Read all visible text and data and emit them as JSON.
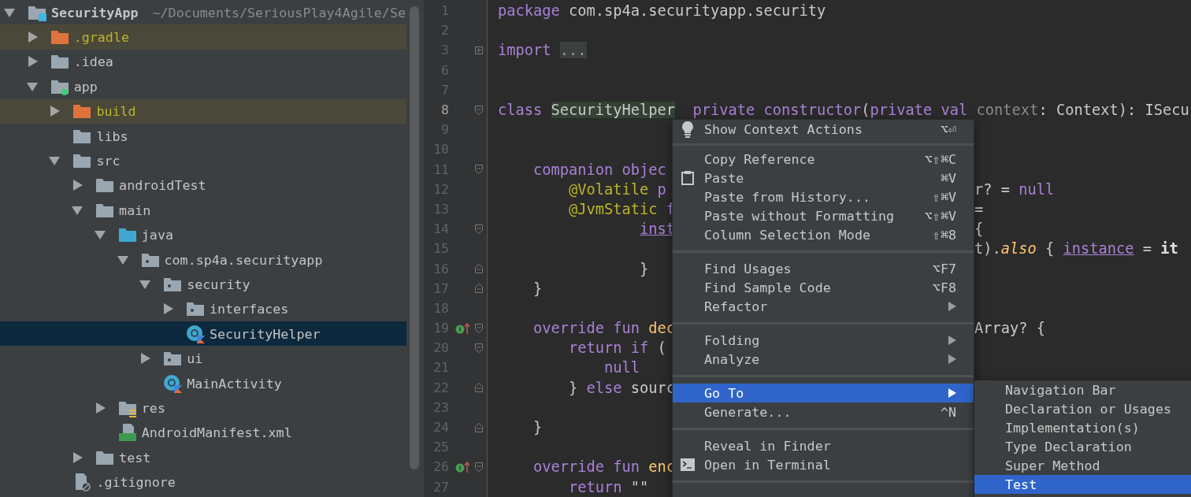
{
  "project_tree": {
    "root": {
      "label": "SecurityApp",
      "path": "~/Documents/SeriousPlay4Agile/Se",
      "kind": "module",
      "expanded": true,
      "selected": false,
      "children": [
        {
          "label": ".gradle",
          "kind": "excluded",
          "expanded": false,
          "selected": false
        },
        {
          "label": ".idea",
          "kind": "folder",
          "expanded": false,
          "selected": false
        },
        {
          "label": "app",
          "kind": "app",
          "expanded": true,
          "selected": false,
          "children": [
            {
              "label": "build",
              "kind": "excluded",
              "expanded": false,
              "selected": false
            },
            {
              "label": "libs",
              "kind": "folder",
              "selected": false
            },
            {
              "label": "src",
              "kind": "folder",
              "expanded": true,
              "selected": false,
              "children": [
                {
                  "label": "androidTest",
                  "kind": "folder",
                  "expanded": false,
                  "selected": false
                },
                {
                  "label": "main",
                  "kind": "folder",
                  "expanded": true,
                  "selected": false,
                  "children": [
                    {
                      "label": "java",
                      "kind": "source",
                      "expanded": true,
                      "selected": false,
                      "children": [
                        {
                          "label": "com.sp4a.securityapp",
                          "kind": "package",
                          "expanded": true,
                          "selected": false,
                          "children": [
                            {
                              "label": "security",
                              "kind": "package",
                              "expanded": true,
                              "selected": false,
                              "children": [
                                {
                                  "label": "interfaces",
                                  "kind": "package",
                                  "expanded": false,
                                  "selected": false
                                },
                                {
                                  "label": "SecurityHelper",
                                  "kind": "kotlin",
                                  "selected": true
                                }
                              ]
                            },
                            {
                              "label": "ui",
                              "kind": "package",
                              "expanded": false,
                              "selected": false
                            },
                            {
                              "label": "MainActivity",
                              "kind": "kotlin",
                              "selected": false
                            }
                          ]
                        }
                      ]
                    },
                    {
                      "label": "res",
                      "kind": "res",
                      "expanded": false,
                      "selected": false
                    },
                    {
                      "label": "AndroidManifest.xml",
                      "kind": "manifest",
                      "selected": false
                    }
                  ]
                },
                {
                  "label": "test",
                  "kind": "folder",
                  "expanded": false,
                  "selected": false
                }
              ]
            },
            {
              "label": ".gitignore",
              "kind": "ignored",
              "selected": false
            }
          ]
        }
      ]
    }
  },
  "editor": {
    "lines": [
      {
        "num": "1",
        "tokens": [
          {
            "kind": "kw",
            "text": "package"
          },
          {
            "kind": "plain",
            "text": " com.sp4a.securityapp.security"
          }
        ]
      },
      {
        "num": "2"
      },
      {
        "num": "3",
        "gutter": [
          {
            "kind": "fold-plus"
          }
        ],
        "tokens": [
          {
            "kind": "kw",
            "text": "import "
          },
          {
            "kind": "folded",
            "text": "..."
          }
        ]
      },
      {
        "num": "6"
      },
      {
        "num": "7"
      },
      {
        "num": "8",
        "current": true,
        "gutter": [
          {
            "kind": "fold-start"
          }
        ],
        "tokens": [
          {
            "kind": "kw",
            "text": "class "
          },
          {
            "kind": "decl",
            "text": "SecurityHelper"
          },
          {
            "kind": "kw",
            "text": "  private constructor"
          },
          {
            "kind": "plain",
            "text": "("
          },
          {
            "kind": "kw",
            "text": "private val "
          },
          {
            "kind": "dim",
            "text": "context"
          },
          {
            "kind": "plain",
            "text": ": Context): ISecu"
          }
        ]
      },
      {
        "num": "9"
      },
      {
        "num": "10"
      },
      {
        "num": "11",
        "gutter": [
          {
            "kind": "fold-start"
          }
        ],
        "tokens": [
          {
            "kind": "kw",
            "text": "    companion objec"
          }
        ]
      },
      {
        "num": "12",
        "tokens": [
          {
            "kind": "ann",
            "text": "        @Volatile"
          },
          {
            "kind": "kw",
            "text": " p"
          }
        ],
        "right": [
          {
            "kind": "plain",
            "text": "r? = "
          },
          {
            "kind": "kw",
            "text": "null"
          }
        ]
      },
      {
        "num": "13",
        "tokens": [
          {
            "kind": "ann",
            "text": "        @JvmStatic"
          },
          {
            "kind": "kw",
            "text": " f"
          }
        ],
        "right": [
          {
            "kind": "plain",
            "text": "="
          }
        ]
      },
      {
        "num": "14",
        "gutter": [
          {
            "kind": "fold-start"
          }
        ],
        "tokens": [
          {
            "kind": "prop",
            "text": "                inst"
          }
        ],
        "right": [
          {
            "kind": "plain",
            "text": "{"
          }
        ]
      },
      {
        "num": "15",
        "right": [
          {
            "kind": "plain",
            "text": "t)."
          },
          {
            "kind": "ext",
            "text": "also"
          },
          {
            "kind": "plain",
            "text": " { "
          },
          {
            "kind": "prop",
            "text": "instance"
          },
          {
            "kind": "plain",
            "text": " = "
          },
          {
            "kind": "bold",
            "text": "it"
          }
        ]
      },
      {
        "num": "16",
        "gutter": [
          {
            "kind": "fold-end"
          }
        ],
        "tokens": [
          {
            "kind": "plain",
            "text": "                }"
          }
        ]
      },
      {
        "num": "17",
        "gutter": [
          {
            "kind": "fold-end"
          }
        ],
        "tokens": [
          {
            "kind": "plain",
            "text": "    }"
          }
        ]
      },
      {
        "num": "18"
      },
      {
        "num": "19",
        "gutter": [
          {
            "kind": "override"
          },
          {
            "kind": "fold-start"
          }
        ],
        "tokens": [
          {
            "kind": "kw",
            "text": "    override fun "
          },
          {
            "kind": "fn",
            "text": "dec"
          }
        ],
        "right": [
          {
            "kind": "plain",
            "text": "Array? {"
          }
        ]
      },
      {
        "num": "20",
        "gutter": [
          {
            "kind": "fold-start"
          }
        ],
        "tokens": [
          {
            "kind": "kw",
            "text": "        return if"
          },
          {
            "kind": "plain",
            "text": " ("
          }
        ]
      },
      {
        "num": "21",
        "tokens": [
          {
            "kind": "kw",
            "text": "            null"
          }
        ]
      },
      {
        "num": "22",
        "gutter": [
          {
            "kind": "fold-end"
          }
        ],
        "tokens": [
          {
            "kind": "plain",
            "text": "        } "
          },
          {
            "kind": "kw",
            "text": "else"
          },
          {
            "kind": "plain",
            "text": " sourc"
          }
        ]
      },
      {
        "num": "23"
      },
      {
        "num": "24",
        "gutter": [
          {
            "kind": "fold-end"
          }
        ],
        "tokens": [
          {
            "kind": "plain",
            "text": "    }"
          }
        ]
      },
      {
        "num": "25"
      },
      {
        "num": "26",
        "gutter": [
          {
            "kind": "override"
          },
          {
            "kind": "fold-start"
          }
        ],
        "tokens": [
          {
            "kind": "kw",
            "text": "    override fun "
          },
          {
            "kind": "fn",
            "text": "enc"
          }
        ]
      },
      {
        "num": "27",
        "tokens": [
          {
            "kind": "kw",
            "text": "        return"
          },
          {
            "kind": "plain",
            "text": " \"\""
          }
        ]
      }
    ]
  },
  "context_menu": {
    "groups": [
      [
        {
          "label": "Show Context Actions",
          "shortcut": "⌥⏎",
          "kind": "bulb",
          "submenu": false,
          "selected": false
        }
      ],
      [
        {
          "label": "Copy Reference",
          "shortcut": "⌥⇧⌘C",
          "submenu": false,
          "selected": false
        },
        {
          "label": "Paste",
          "shortcut": "⌘V",
          "kind": "clipboard",
          "submenu": false,
          "selected": false
        },
        {
          "label": "Paste from History...",
          "shortcut": "⇧⌘V",
          "submenu": false,
          "selected": false
        },
        {
          "label": "Paste without Formatting",
          "shortcut": "⌥⇧⌘V",
          "submenu": false,
          "selected": false
        },
        {
          "label": "Column Selection Mode",
          "shortcut": "⇧⌘8",
          "submenu": false,
          "selected": false
        }
      ],
      [
        {
          "label": "Find Usages",
          "shortcut": "⌥F7",
          "submenu": false,
          "selected": false
        },
        {
          "label": "Find Sample Code",
          "shortcut": "⌥F8",
          "submenu": false,
          "selected": false
        },
        {
          "label": "Refactor",
          "submenu": true,
          "selected": false
        }
      ],
      [
        {
          "label": "Folding",
          "submenu": true,
          "selected": false
        },
        {
          "label": "Analyze",
          "submenu": true,
          "selected": false
        }
      ],
      [
        {
          "label": "Go To",
          "submenu": true,
          "selected": true
        },
        {
          "label": "Generate...",
          "shortcut": "^N",
          "submenu": false,
          "selected": false
        }
      ],
      [
        {
          "label": "Reveal in Finder",
          "submenu": false,
          "selected": false
        },
        {
          "label": "Open in Terminal",
          "kind": "terminal",
          "submenu": false,
          "selected": false
        }
      ]
    ]
  },
  "submenu": {
    "items": [
      {
        "label": "Navigation Bar",
        "selected": false
      },
      {
        "label": "Declaration or Usages",
        "selected": false
      },
      {
        "label": "Implementation(s)",
        "selected": false
      },
      {
        "label": "Type Declaration",
        "selected": false
      },
      {
        "label": "Super Method",
        "selected": false
      },
      {
        "label": "Test",
        "selected": true
      }
    ]
  }
}
